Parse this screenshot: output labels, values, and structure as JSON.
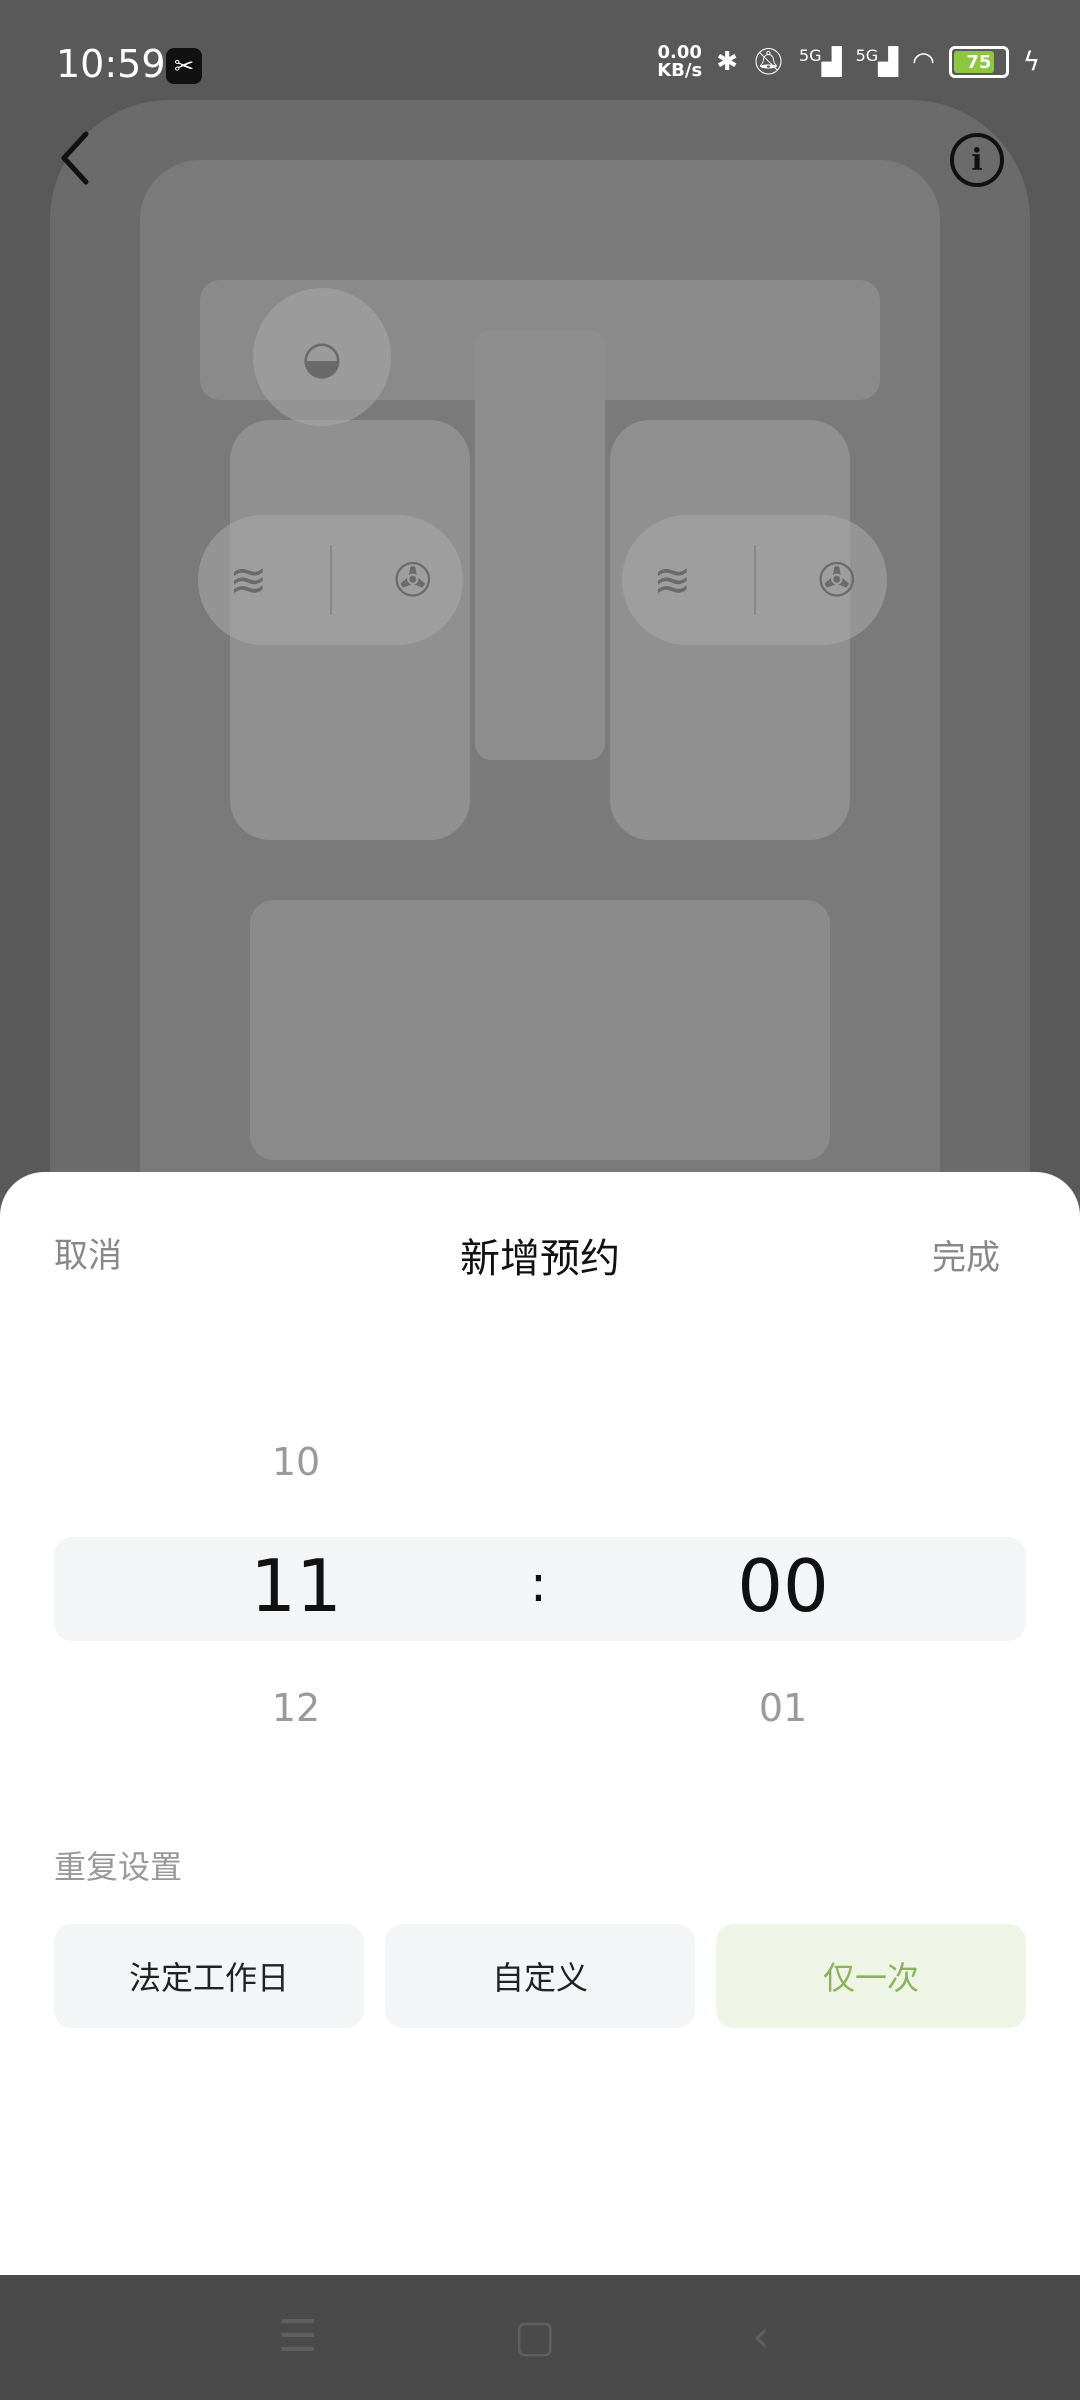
{
  "status_bar": {
    "time": "10:59",
    "net_speed_value": "0.00",
    "net_speed_unit": "KB/s",
    "signal1": "5G",
    "signal2": "5G",
    "battery": "75"
  },
  "icons": {
    "back": "back-chevron-icon",
    "info": "info-icon",
    "steering": "steering-wheel-heat-icon",
    "seat_heat": "seat-heat-icon",
    "seat_fan": "seat-ventilation-icon"
  },
  "sheet": {
    "cancel": "取消",
    "title": "新增预约",
    "done": "完成"
  },
  "picker": {
    "hours": {
      "prev": "10",
      "selected": "11",
      "next": "12"
    },
    "separator": ":",
    "minutes": {
      "prev": "",
      "selected": "00",
      "next": "01"
    }
  },
  "repeat": {
    "label": "重复设置",
    "options": [
      {
        "label": "法定工作日",
        "selected": false
      },
      {
        "label": "自定义",
        "selected": false
      },
      {
        "label": "仅一次",
        "selected": true
      }
    ]
  },
  "colors": {
    "accent": "#8bb35a",
    "accent_bg": "#eef4e6",
    "battery": "#8dc63f"
  }
}
